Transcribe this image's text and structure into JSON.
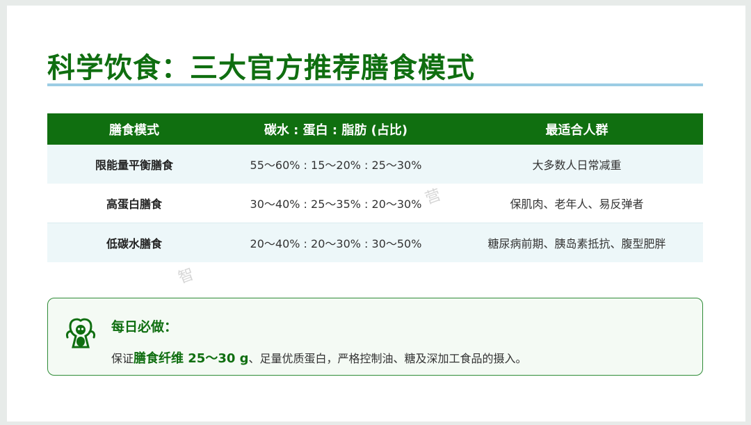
{
  "title": "科学饮食：三大官方推荐膳食模式",
  "table": {
    "headers": [
      "膳食模式",
      "碳水 : 蛋白 : 脂肪 (占比)",
      "最适合人群"
    ],
    "rows": [
      {
        "mode": "限能量平衡膳食",
        "ratio": "55～60% : 15～20% : 25～30%",
        "audience": "大多数人日常减重"
      },
      {
        "mode": "高蛋白膳食",
        "ratio": "30～40% : 25～35% : 20～30%",
        "audience": "保肌肉、老年人、易反弹者"
      },
      {
        "mode": "低碳水膳食",
        "ratio": "20～40% : 20～30% : 30～50%",
        "audience": "糖尿病前期、胰岛素抵抗、腹型肥胖"
      }
    ]
  },
  "watermarks": [
    "营",
    "智"
  ],
  "tip": {
    "icon": "mascot-icon",
    "heading": "每日必做：",
    "text_prefix": "保证",
    "text_emphasis": "膳食纤维 25～30 g",
    "text_suffix": "、足量优质蛋白，严格控制油、糖及深加工食品的摄入。"
  },
  "colors": {
    "brand_green": "#0f6e10",
    "header_green": "#106f10",
    "rule_blue": "#9ccde4",
    "row_shade": "#edf7f9"
  }
}
